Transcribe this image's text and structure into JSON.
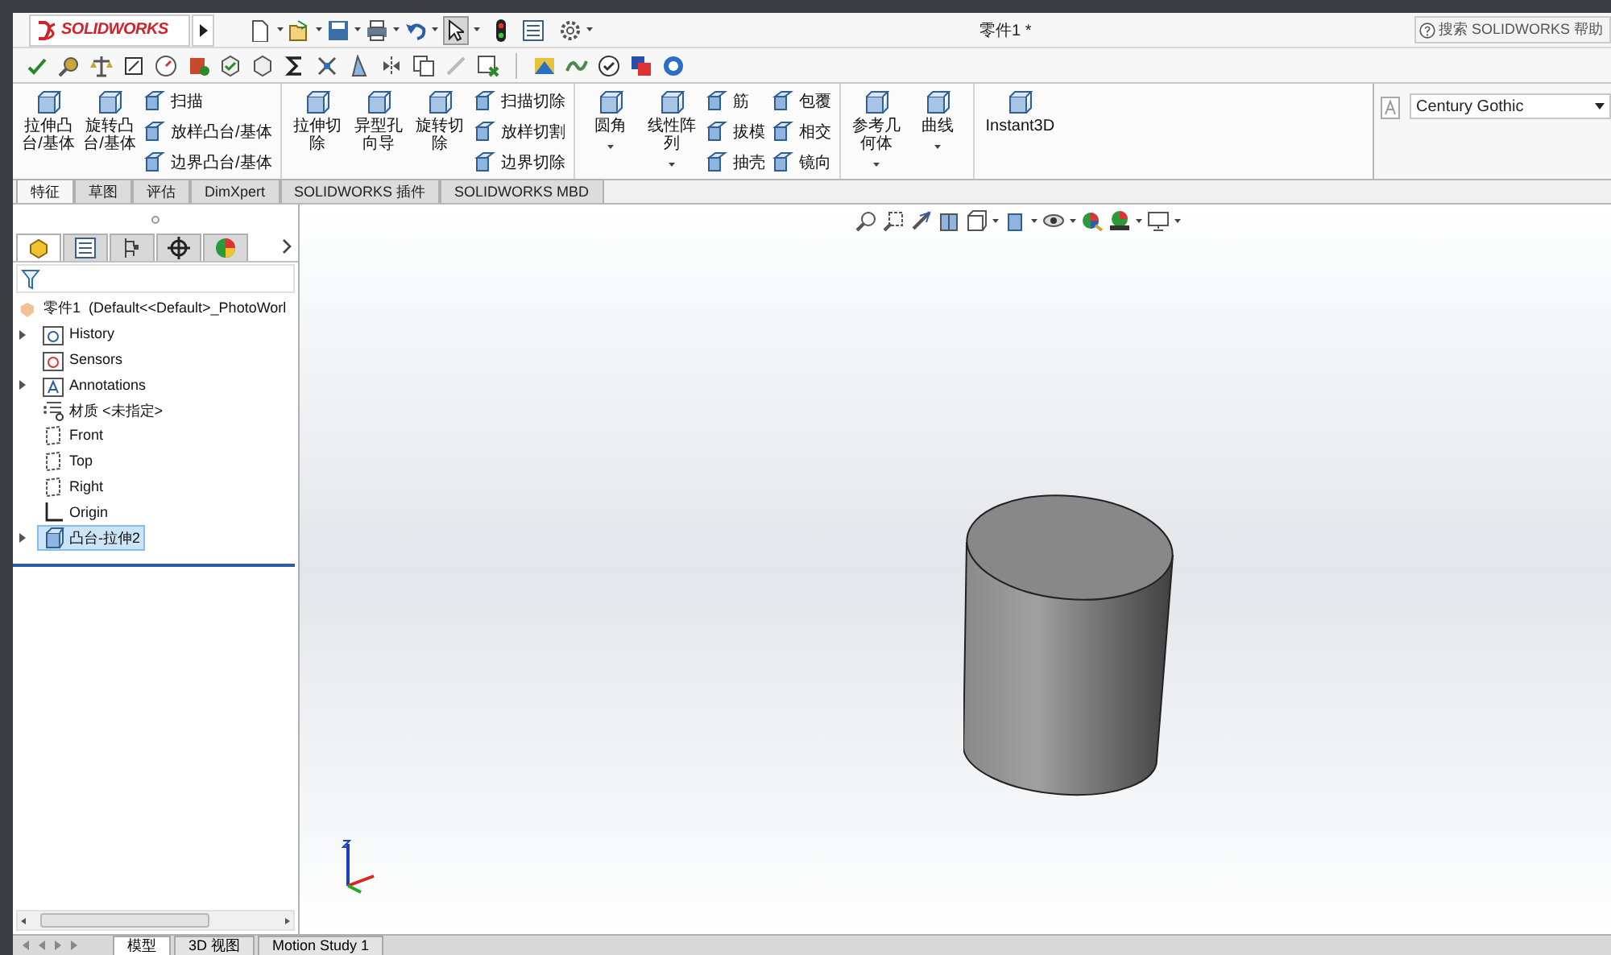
{
  "window": {
    "title": "零件1 *"
  },
  "logo": {
    "text": "SOLIDWORKS"
  },
  "help_search": {
    "placeholder": "搜索 SOLIDWORKS 帮助"
  },
  "ribbon": {
    "groups": [
      {
        "commands": [
          {
            "kind": "large",
            "label": "拉伸凸台/基体",
            "dropdown": false
          },
          {
            "kind": "large",
            "label": "旋转凸台/基体",
            "dropdown": false
          },
          {
            "kind": "stack",
            "items": [
              {
                "label": "扫描"
              },
              {
                "label": "放样凸台/基体"
              },
              {
                "label": "边界凸台/基体"
              }
            ]
          }
        ]
      },
      {
        "commands": [
          {
            "kind": "large",
            "label": "拉伸切除",
            "dropdown": false
          },
          {
            "kind": "large",
            "label": "异型孔向导",
            "dropdown": false
          },
          {
            "kind": "large",
            "label": "旋转切除",
            "dropdown": false
          },
          {
            "kind": "stack",
            "items": [
              {
                "label": "扫描切除"
              },
              {
                "label": "放样切割"
              },
              {
                "label": "边界切除"
              }
            ]
          }
        ]
      },
      {
        "commands": [
          {
            "kind": "large",
            "label": "圆角",
            "dropdown": true
          },
          {
            "kind": "large",
            "label": "线性阵列",
            "dropdown": true
          },
          {
            "kind": "stack",
            "items": [
              {
                "label": "筋"
              },
              {
                "label": "拔模"
              },
              {
                "label": "抽壳"
              }
            ]
          },
          {
            "kind": "stack",
            "items": [
              {
                "label": "包覆"
              },
              {
                "label": "相交"
              },
              {
                "label": "镜向"
              }
            ]
          }
        ]
      },
      {
        "commands": [
          {
            "kind": "large",
            "label": "参考几何体",
            "dropdown": true
          },
          {
            "kind": "large",
            "label": "曲线",
            "dropdown": true
          }
        ]
      },
      {
        "commands": [
          {
            "kind": "wide",
            "label": "Instant3D",
            "dropdown": false
          }
        ]
      }
    ]
  },
  "font_selector": {
    "value": "Century Gothic"
  },
  "tabs": [
    {
      "label": "特征",
      "selected": true
    },
    {
      "label": "草图",
      "selected": false
    },
    {
      "label": "评估",
      "selected": false
    },
    {
      "label": "DimXpert",
      "selected": false
    },
    {
      "label": "SOLIDWORKS 插件",
      "selected": false
    },
    {
      "label": "SOLIDWORKS MBD",
      "selected": false
    }
  ],
  "manager_tabs": [
    {
      "kind": "feature",
      "selected": true
    },
    {
      "kind": "property",
      "selected": false
    },
    {
      "kind": "config",
      "selected": false
    },
    {
      "kind": "dimxpert",
      "selected": false
    },
    {
      "kind": "display",
      "selected": false
    }
  ],
  "tree": {
    "label": "零件1  (Default<<Default>_PhotoWorl",
    "children": [
      {
        "kind": "history",
        "label": "History",
        "expandable": true,
        "selected": false
      },
      {
        "kind": "sensor",
        "label": "Sensors",
        "expandable": false,
        "selected": false
      },
      {
        "kind": "annotation",
        "label": "Annotations",
        "expandable": true,
        "selected": false
      },
      {
        "kind": "material",
        "label": "材质 <未指定>",
        "expandable": false,
        "selected": false
      },
      {
        "kind": "plane",
        "label": "Front",
        "expandable": false,
        "selected": false
      },
      {
        "kind": "plane",
        "label": "Top",
        "expandable": false,
        "selected": false
      },
      {
        "kind": "plane",
        "label": "Right",
        "expandable": false,
        "selected": false
      },
      {
        "kind": "origin",
        "label": "Origin",
        "expandable": false,
        "selected": false
      },
      {
        "kind": "feature",
        "label": "凸台-拉伸2",
        "expandable": true,
        "selected": true
      }
    ]
  },
  "bottom_tabs": [
    {
      "label": "模型",
      "selected": true
    },
    {
      "label": "3D 视图",
      "selected": false
    },
    {
      "label": "Motion Study 1",
      "selected": false
    }
  ]
}
